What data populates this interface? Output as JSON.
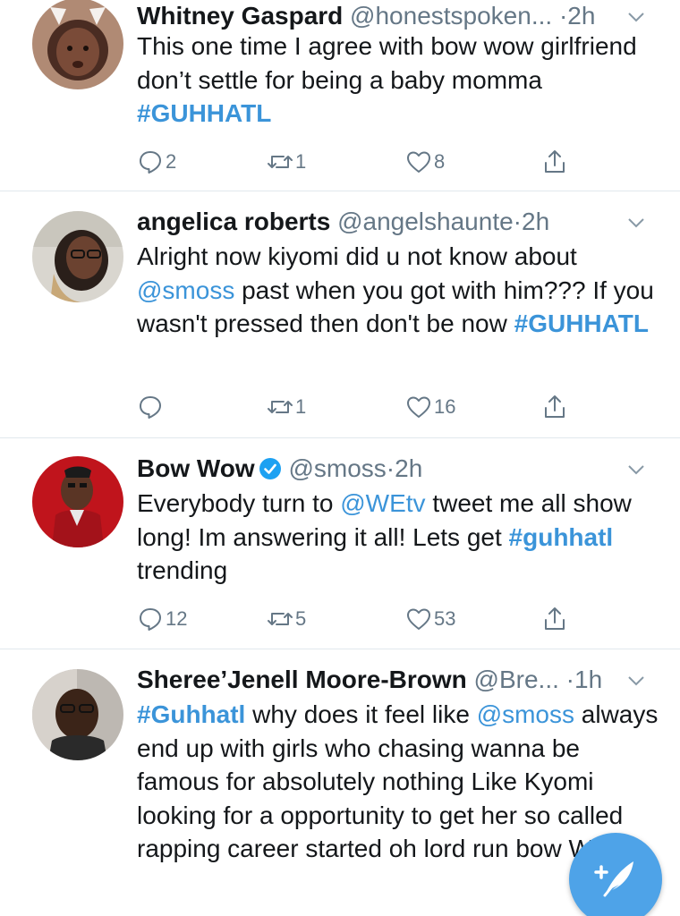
{
  "colors": {
    "link": "#3b94d9",
    "muted": "#657786",
    "fab": "#4ea3e8",
    "divider": "#e1e8ed"
  },
  "tweets": [
    {
      "name": "Whitney Gaspard",
      "handle": "@honestspoken...",
      "dot": "·",
      "time": "2h",
      "body": [
        {
          "text": "This one time I agree with bow wow girlfriend don’t settle for being a baby momma ",
          "type": "text"
        },
        {
          "text": "#GUHHATL",
          "type": "tag"
        }
      ],
      "replies": "2",
      "retweets": "1",
      "likes": "8"
    },
    {
      "name": "angelica roberts",
      "handle": "@angelshaunte",
      "dot": "·",
      "time": "2h",
      "body": [
        {
          "text": "Alright now kiyomi did u not know about ",
          "type": "text"
        },
        {
          "text": "@smoss",
          "type": "link"
        },
        {
          "text": " past when you got with him??? If you wasn't pressed then don't be now ",
          "type": "text"
        },
        {
          "text": "#GUHHATL",
          "type": "tag"
        }
      ],
      "replies": "",
      "retweets": "1",
      "likes": "16"
    },
    {
      "name": "Bow Wow",
      "handle": "@smoss",
      "dot": "·",
      "time": "2h",
      "verified": true,
      "body": [
        {
          "text": "Everybody turn to ",
          "type": "text"
        },
        {
          "text": "@WEtv",
          "type": "link"
        },
        {
          "text": " tweet me all show long! Im answering it all! Lets get ",
          "type": "text"
        },
        {
          "text": "#guhhatl",
          "type": "tag"
        },
        {
          "text": " trending",
          "type": "text"
        }
      ],
      "replies": "12",
      "retweets": "5",
      "likes": "53"
    },
    {
      "name": "Sheree’Jenell Moore-Brown",
      "handle": "@Bre...",
      "dot": "·",
      "time": "1h",
      "body": [
        {
          "text": "#Guhhatl",
          "type": "tag"
        },
        {
          "text": " why does it feel like ",
          "type": "text"
        },
        {
          "text": "@smoss",
          "type": "link"
        },
        {
          "text": " always end up with girls who chasing wanna be famous for absolutely nothing Like Kyomi looking for a opportunity to get her so called rapping career started oh lord  run bow Wow",
          "type": "text"
        }
      ],
      "replies": "",
      "retweets": "",
      "likes": ""
    }
  ],
  "compose": {
    "icon": "compose-tweet-icon"
  }
}
